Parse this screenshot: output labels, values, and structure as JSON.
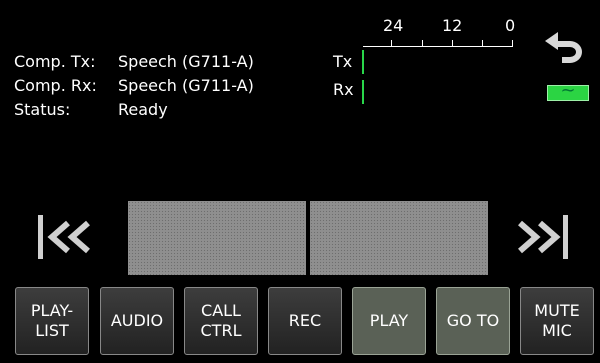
{
  "info": {
    "comp_tx_label": "Comp. Tx:",
    "comp_tx_value": "Speech (G711-A)",
    "comp_rx_label": "Comp. Rx:",
    "comp_rx_value": "Speech (G711-A)",
    "status_label": "Status:",
    "status_value": "Ready"
  },
  "meter": {
    "tx_label": "Tx",
    "rx_label": "Rx",
    "scale": [
      "24",
      "12",
      "0"
    ]
  },
  "icons": {
    "undo": "undo-arrow-icon",
    "indicator": "green-tilde-indicator-icon",
    "indicator_glyph": "~",
    "skip_back": "skip-back-icon",
    "skip_forward": "skip-forward-icon"
  },
  "colors": {
    "meter_bar": "#29d64a",
    "indicator": "#2bd443",
    "waveform": "#8f8f8f",
    "button_active": "#5a6156"
  },
  "buttons": [
    {
      "line1": "PLAY-",
      "line2": "LIST"
    },
    {
      "line1": "AUDIO",
      "line2": ""
    },
    {
      "line1": "CALL",
      "line2": "CTRL"
    },
    {
      "line1": "REC",
      "line2": ""
    },
    {
      "line1": "PLAY",
      "line2": ""
    },
    {
      "line1": "GO TO",
      "line2": ""
    },
    {
      "line1": "MUTE",
      "line2": "MIC"
    }
  ]
}
